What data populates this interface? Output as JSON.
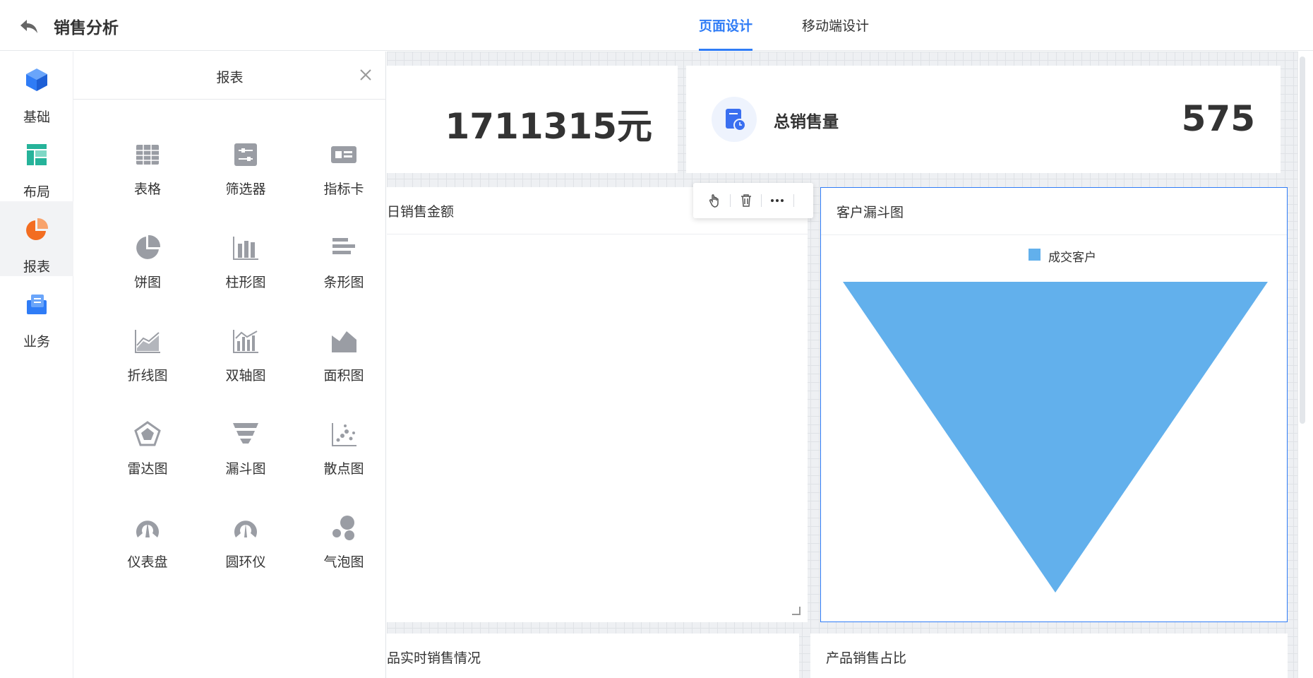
{
  "header": {
    "title": "销售分析",
    "tabs": [
      {
        "label": "页面设计",
        "active": true
      },
      {
        "label": "移动端设计",
        "active": false
      }
    ]
  },
  "nav": {
    "items": [
      {
        "label": "基础",
        "icon": "cube-icon",
        "color": "#2f7cf6",
        "active": false
      },
      {
        "label": "布局",
        "icon": "layout-icon",
        "color": "#26b39a",
        "active": false
      },
      {
        "label": "报表",
        "icon": "pie-chart-icon",
        "color": "#f36d21",
        "active": true
      },
      {
        "label": "业务",
        "icon": "briefcase-icon",
        "color": "#2f7cf6",
        "active": false
      }
    ]
  },
  "panel": {
    "title": "报表",
    "items": [
      {
        "label": "表格",
        "icon": "table-icon"
      },
      {
        "label": "筛选器",
        "icon": "filter-icon"
      },
      {
        "label": "指标卡",
        "icon": "indicator-card-icon"
      },
      {
        "label": "饼图",
        "icon": "pie-icon"
      },
      {
        "label": "柱形图",
        "icon": "column-chart-icon"
      },
      {
        "label": "条形图",
        "icon": "bar-chart-icon"
      },
      {
        "label": "折线图",
        "icon": "line-chart-icon"
      },
      {
        "label": "双轴图",
        "icon": "dual-axis-icon"
      },
      {
        "label": "面积图",
        "icon": "area-chart-icon"
      },
      {
        "label": "雷达图",
        "icon": "radar-chart-icon"
      },
      {
        "label": "漏斗图",
        "icon": "funnel-icon"
      },
      {
        "label": "散点图",
        "icon": "scatter-icon"
      },
      {
        "label": "仪表盘",
        "icon": "gauge-icon"
      },
      {
        "label": "圆环仪",
        "icon": "ring-gauge-icon"
      },
      {
        "label": "气泡图",
        "icon": "bubble-icon"
      }
    ]
  },
  "canvas": {
    "kpi_left": {
      "value": "1711315元"
    },
    "kpi_right": {
      "label": "总销售量",
      "value": "575"
    },
    "chart_left": {
      "title": "日销售金额"
    },
    "chart_right": {
      "title": "客户漏斗图",
      "legend": "成交客户",
      "color": "#62b0ec"
    },
    "bottom_left": {
      "title": "品实时销售情况"
    },
    "bottom_right": {
      "title": "产品销售占比"
    }
  }
}
